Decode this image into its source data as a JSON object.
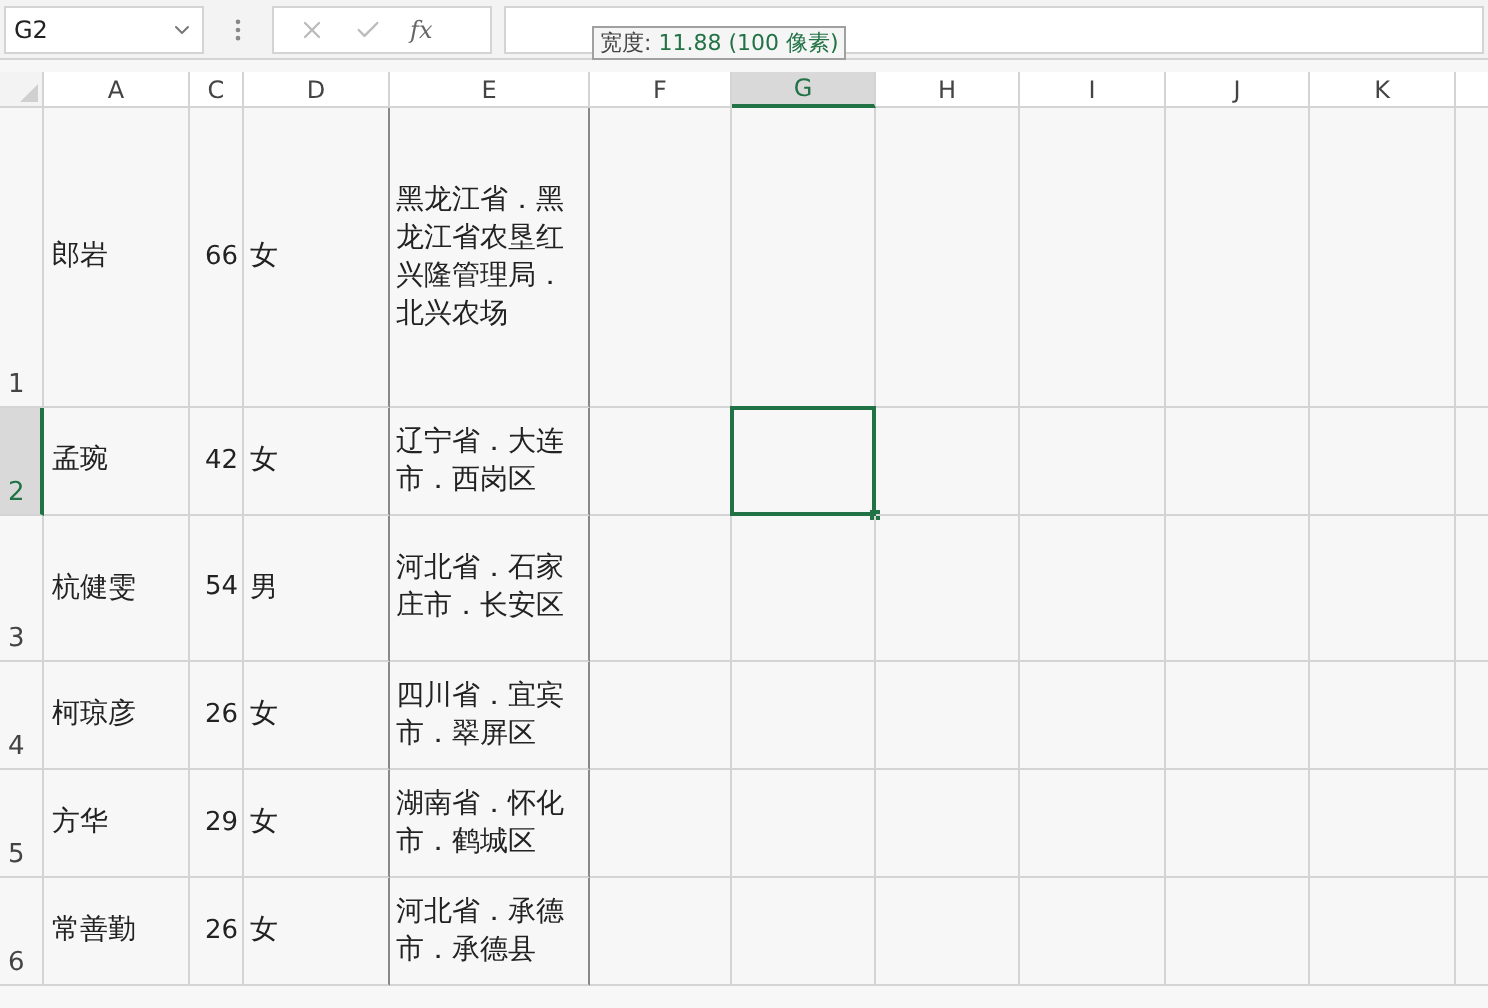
{
  "name_box": {
    "value": "G2"
  },
  "formula_bar": {
    "function_label": "fx"
  },
  "tooltip": {
    "label": "宽度:",
    "value": "11.88 (100 像素)"
  },
  "columns": [
    {
      "label": "A",
      "selected": false
    },
    {
      "label": "C",
      "selected": false
    },
    {
      "label": "D",
      "selected": false
    },
    {
      "label": "E",
      "selected": false
    },
    {
      "label": "F",
      "selected": false
    },
    {
      "label": "G",
      "selected": true
    },
    {
      "label": "H",
      "selected": false
    },
    {
      "label": "I",
      "selected": false
    },
    {
      "label": "J",
      "selected": false
    },
    {
      "label": "K",
      "selected": false
    }
  ],
  "rows": [
    {
      "number": "1",
      "selected": false,
      "name": "郎岩",
      "age": "66",
      "gender": "女",
      "address": "黑龙江省．黑龙江省农垦红兴隆管理局．北兴农场"
    },
    {
      "number": "2",
      "selected": true,
      "name": "孟琬",
      "age": "42",
      "gender": "女",
      "address": "辽宁省．大连市．西岗区"
    },
    {
      "number": "3",
      "selected": false,
      "name": "杭健雯",
      "age": "54",
      "gender": "男",
      "address": "河北省．石家庄市．长安区"
    },
    {
      "number": "4",
      "selected": false,
      "name": "柯琼彦",
      "age": "26",
      "gender": "女",
      "address": "四川省．宜宾市．翠屏区"
    },
    {
      "number": "5",
      "selected": false,
      "name": "方华",
      "age": "29",
      "gender": "女",
      "address": "湖南省．怀化市．鹤城区"
    },
    {
      "number": "6",
      "selected": false,
      "name": "常善勤",
      "age": "26",
      "gender": "女",
      "address": "河北省．承德市．承德县"
    }
  ]
}
